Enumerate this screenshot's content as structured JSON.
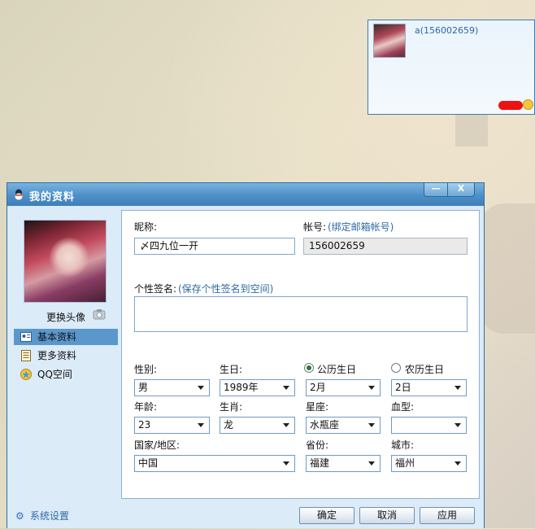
{
  "notification": {
    "contact": "a(156002659)"
  },
  "window": {
    "title": "我的资料",
    "minimize_label": "—",
    "close_label": "X"
  },
  "sidebar": {
    "change_avatar": "更换头像",
    "items": [
      {
        "label": "基本资料",
        "active": true
      },
      {
        "label": "更多资料",
        "active": false
      },
      {
        "label": "QQ空间",
        "active": false
      }
    ]
  },
  "form": {
    "nickname_label": "昵称:",
    "nickname_value": "〆四九位一开",
    "account_label": "帐号:",
    "account_link": "(绑定邮箱帐号)",
    "account_value": "156002659",
    "signature_label": "个性签名:",
    "signature_link": "(保存个性签名到空间)",
    "signature_value": "",
    "gender_label": "性别:",
    "gender_value": "男",
    "birthday_label": "生日:",
    "birth_year": "1989年",
    "calendar_solar": "公历生日",
    "calendar_lunar": "农历生日",
    "calendar_selected": "solar",
    "birth_month": "2月",
    "birth_day": "2日",
    "age_label": "年龄:",
    "age_value": "23",
    "zodiac_label": "生肖:",
    "zodiac_value": "龙",
    "constellation_label": "星座:",
    "constellation_value": "水瓶座",
    "blood_label": "血型:",
    "blood_value": "",
    "country_label": "国家/地区:",
    "country_value": "中国",
    "province_label": "省份:",
    "province_value": "福建",
    "city_label": "城市:",
    "city_value": "福州"
  },
  "footer": {
    "settings": "系统设置",
    "ok": "确定",
    "cancel": "取消",
    "apply": "应用"
  }
}
